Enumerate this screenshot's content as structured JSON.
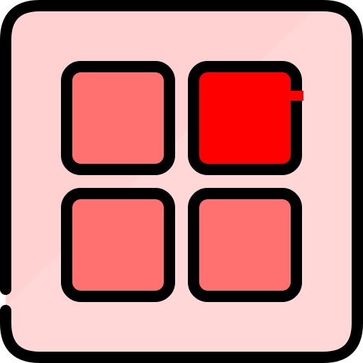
{
  "icon": {
    "name": "grid-view-icon",
    "colors": {
      "outline": "#000000",
      "frame_fill": "#ffd1d1",
      "frame_highlight": "#ffe1e1",
      "tile_normal": "#ff7070",
      "tile_active": "#ff0000"
    },
    "grid": {
      "rows": 2,
      "cols": 2,
      "active_tile_index": 1
    }
  }
}
